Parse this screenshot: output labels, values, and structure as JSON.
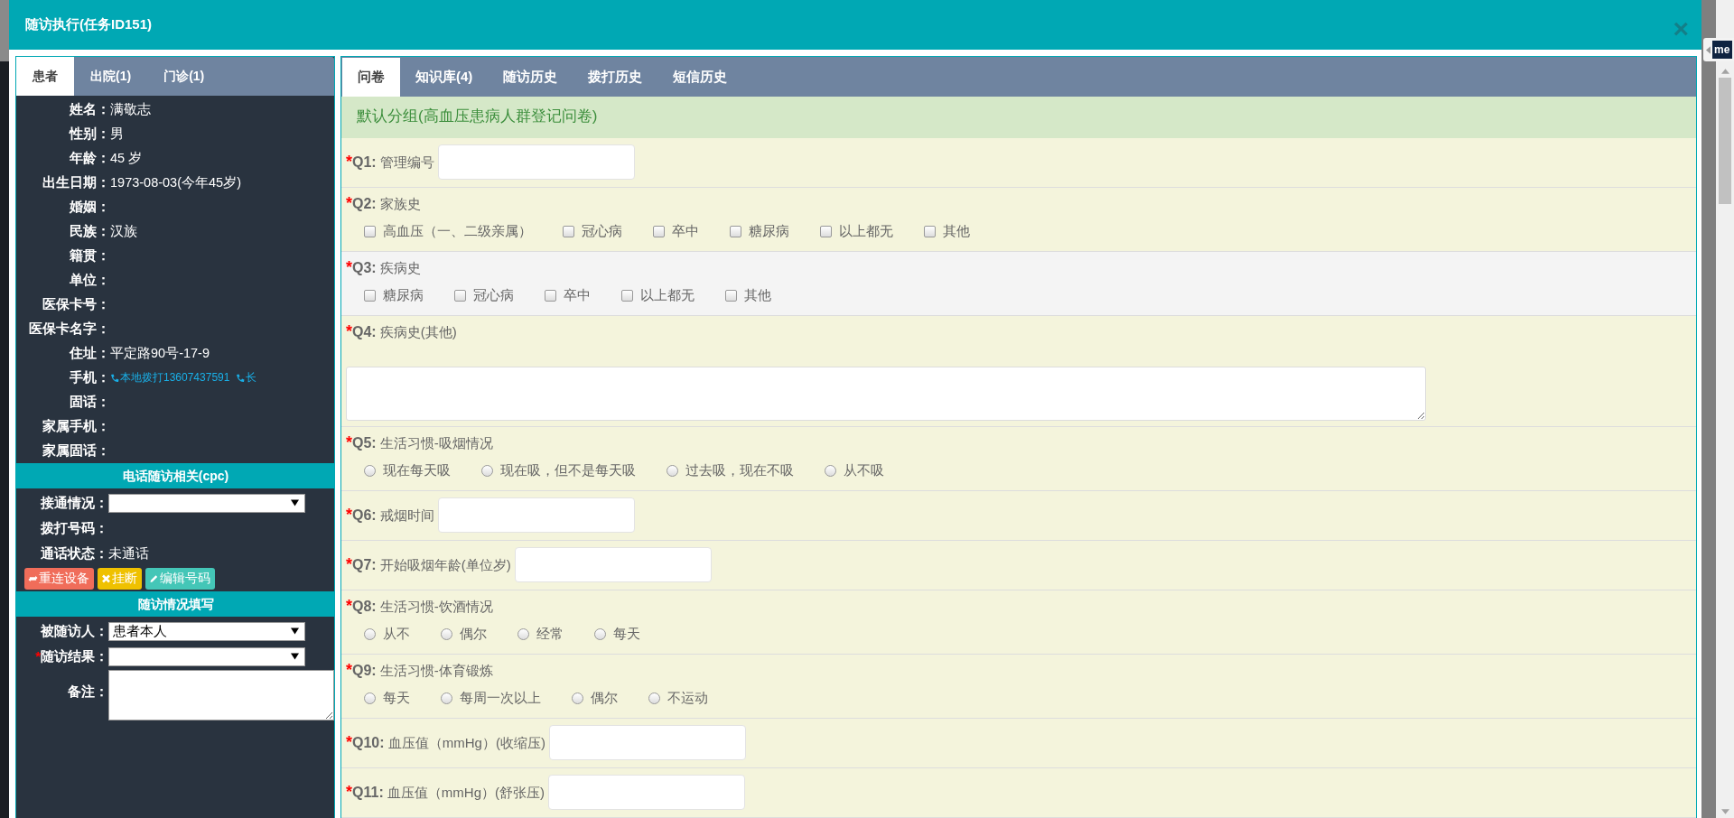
{
  "window": {
    "title": "随访执行(任务ID151)",
    "close": "×"
  },
  "left_panel": {
    "tabs": [
      {
        "label": "患者",
        "selected": true
      },
      {
        "label": "出院(1)",
        "selected": false
      },
      {
        "label": "门诊(1)",
        "selected": false
      }
    ],
    "patient_fields": [
      {
        "label": "姓名：",
        "kind": "text",
        "value": "满敬志"
      },
      {
        "label": "性别：",
        "kind": "text",
        "value": "男"
      },
      {
        "label": "年龄：",
        "kind": "text",
        "value": "45 岁"
      },
      {
        "label": "出生日期：",
        "kind": "text",
        "value": "1973-08-03(今年45岁)"
      },
      {
        "label": "婚姻：",
        "kind": "text"
      },
      {
        "label": "民族：",
        "kind": "text",
        "value": "汉族"
      },
      {
        "label": "籍贯：",
        "kind": "text"
      },
      {
        "label": "单位：",
        "kind": "text"
      },
      {
        "label": "医保卡号：",
        "kind": "text"
      },
      {
        "label": "医保卡名字：",
        "kind": "text"
      },
      {
        "label": "住址：",
        "kind": "text",
        "value": "平定路90号-17-9"
      },
      {
        "label": "手机：",
        "kind": "phone",
        "links": [
          "本地拨打13607437591",
          "长"
        ]
      },
      {
        "label": "固话：",
        "kind": "text"
      },
      {
        "label": "家属手机：",
        "kind": "text"
      },
      {
        "label": "家属固话：",
        "kind": "text"
      }
    ],
    "phone_section": {
      "title": "电话随访相关(cpc)",
      "fields": [
        {
          "label": "接通情况：",
          "kind": "select"
        },
        {
          "label": "拨打号码：",
          "kind": "text"
        },
        {
          "label": "通话状态：",
          "kind": "text",
          "value": "未通话"
        }
      ],
      "buttons": [
        {
          "label": "重连设备",
          "kind": "reconnect"
        },
        {
          "label": "挂断",
          "kind": "hangup"
        },
        {
          "label": "编辑号码",
          "kind": "edit"
        }
      ]
    },
    "followup_section": {
      "title": "随访情况填写",
      "fields": [
        {
          "label": "被随访人：",
          "kind": "select",
          "value": "患者本人"
        },
        {
          "label": "随访结果：",
          "kind": "select",
          "mark": "*"
        },
        {
          "label": "备注：",
          "kind": "textarea"
        }
      ]
    }
  },
  "right_panel": {
    "tabs": [
      {
        "label": "问卷",
        "selected": true
      },
      {
        "label": "知识库(4)",
        "selected": false
      },
      {
        "label": "随访历史",
        "selected": false
      },
      {
        "label": "拨打历史",
        "selected": false
      },
      {
        "label": "短信历史",
        "selected": false
      }
    ],
    "group_title": "默认分组(高血压患病人群登记问卷)",
    "questions": [
      {
        "mark": "*",
        "number": "Q1:",
        "text": "管理编号",
        "kind": "input",
        "highlighted": false
      },
      {
        "mark": "*",
        "number": "Q2:",
        "text": "家族史",
        "kind": "checkbox",
        "highlighted": false,
        "options": [
          {
            "label": "高血压（一、二级亲属）",
            "checked": false
          },
          {
            "label": "冠心病",
            "checked": false
          },
          {
            "label": "卒中",
            "checked": false
          },
          {
            "label": "糖尿病",
            "checked": false
          },
          {
            "label": "以上都无",
            "checked": false
          },
          {
            "label": "其他",
            "checked": false
          }
        ]
      },
      {
        "mark": "*",
        "number": "Q3:",
        "text": "疾病史",
        "kind": "checkbox",
        "highlighted": true,
        "options": [
          {
            "label": "糖尿病",
            "checked": false
          },
          {
            "label": "冠心病",
            "checked": false
          },
          {
            "label": "卒中",
            "checked": false
          },
          {
            "label": "以上都无",
            "checked": false
          },
          {
            "label": "其他",
            "checked": false
          }
        ]
      },
      {
        "mark": "*",
        "number": "Q4:",
        "text": "疾病史(其他)",
        "kind": "textarea",
        "highlighted": false
      },
      {
        "mark": "*",
        "number": "Q5:",
        "text": "生活习惯-吸烟情况",
        "kind": "radio",
        "highlighted": false,
        "options": [
          {
            "label": "现在每天吸",
            "checked": false
          },
          {
            "label": "现在吸，但不是每天吸",
            "checked": false
          },
          {
            "label": "过去吸，现在不吸",
            "checked": false
          },
          {
            "label": "从不吸",
            "checked": false
          }
        ]
      },
      {
        "mark": "*",
        "number": "Q6:",
        "text": "戒烟时间",
        "kind": "input",
        "highlighted": false
      },
      {
        "mark": "*",
        "number": "Q7:",
        "text": "开始吸烟年龄(单位岁)",
        "kind": "input",
        "highlighted": false
      },
      {
        "mark": "*",
        "number": "Q8:",
        "text": "生活习惯-饮酒情况",
        "kind": "radio",
        "highlighted": false,
        "options": [
          {
            "label": "从不",
            "checked": false
          },
          {
            "label": "偶尔",
            "checked": false
          },
          {
            "label": "经常",
            "checked": false
          },
          {
            "label": "每天",
            "checked": false
          }
        ]
      },
      {
        "mark": "*",
        "number": "Q9:",
        "text": "生活习惯-体育锻炼",
        "kind": "radio",
        "highlighted": false,
        "options": [
          {
            "label": "每天",
            "checked": false
          },
          {
            "label": "每周一次以上",
            "checked": false
          },
          {
            "label": "偶尔",
            "checked": false
          },
          {
            "label": "不运动",
            "checked": false
          }
        ]
      },
      {
        "mark": "*",
        "number": "Q10:",
        "text": "血压值（mmHg）(收缩压)",
        "kind": "input",
        "highlighted": false
      },
      {
        "mark": "*",
        "number": "Q11:",
        "text": "血压值（mmHg）(舒张压)",
        "kind": "input",
        "highlighted": false
      }
    ]
  },
  "side_widget": {
    "label": "me"
  }
}
